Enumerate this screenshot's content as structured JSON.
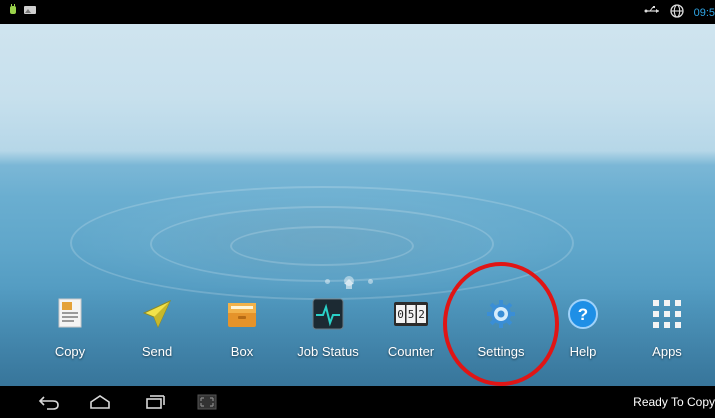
{
  "status_bar": {
    "time": "09:5"
  },
  "apps": [
    {
      "id": "copy",
      "label": "Copy",
      "icon": "copy-icon"
    },
    {
      "id": "send",
      "label": "Send",
      "icon": "paper-plane-icon"
    },
    {
      "id": "box",
      "label": "Box",
      "icon": "folder-box-icon"
    },
    {
      "id": "job-status",
      "label": "Job Status",
      "icon": "heartbeat-monitor-icon"
    },
    {
      "id": "counter",
      "label": "Counter",
      "icon": "counter-digits-icon",
      "digits": "052"
    },
    {
      "id": "settings",
      "label": "Settings",
      "icon": "gear-icon"
    },
    {
      "id": "help",
      "label": "Help",
      "icon": "help-question-icon",
      "glyph": "?"
    },
    {
      "id": "apps",
      "label": "Apps",
      "icon": "apps-grid-icon"
    }
  ],
  "nav": {
    "status_text": "Ready To Copy"
  },
  "colors": {
    "highlight": "#e01515",
    "status_accent": "#2fa6e6",
    "help_blue": "#1e8fe6"
  }
}
